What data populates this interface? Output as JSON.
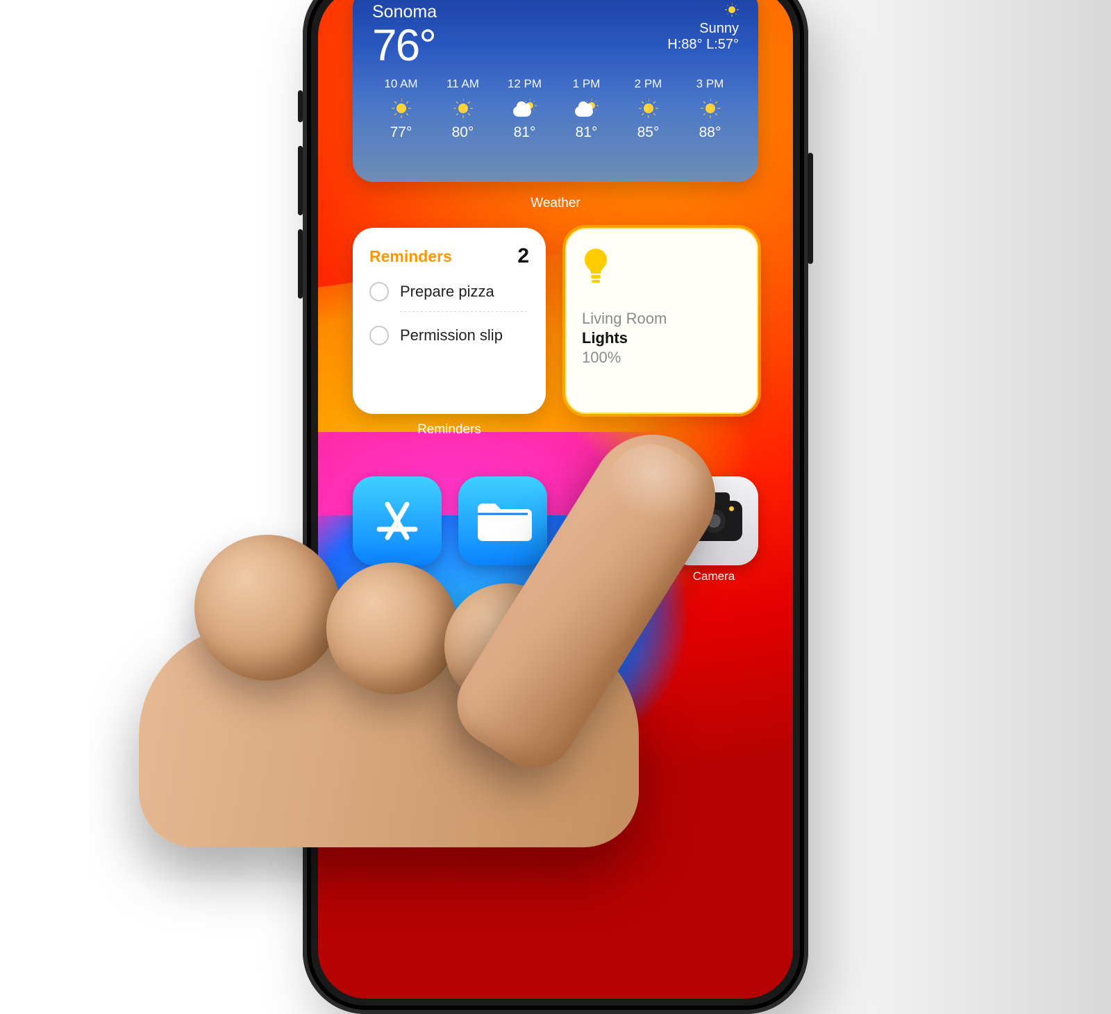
{
  "weather": {
    "location": "Sonoma",
    "current_temp": "76°",
    "condition": "Sunny",
    "hi_lo": "H:88° L:57°",
    "caption": "Weather",
    "hours": [
      {
        "time": "10 AM",
        "icon": "sun",
        "temp": "77°"
      },
      {
        "time": "11 AM",
        "icon": "sun",
        "temp": "80°"
      },
      {
        "time": "12 PM",
        "icon": "partly-cloudy",
        "temp": "81°"
      },
      {
        "time": "1 PM",
        "icon": "partly-cloudy",
        "temp": "81°"
      },
      {
        "time": "2 PM",
        "icon": "sun",
        "temp": "85°"
      },
      {
        "time": "3 PM",
        "icon": "sun",
        "temp": "88°"
      }
    ]
  },
  "reminders": {
    "title": "Reminders",
    "count": "2",
    "items": [
      {
        "text": "Prepare pizza"
      },
      {
        "text": "Permission slip"
      }
    ],
    "caption": "Reminders"
  },
  "home": {
    "room": "Living Room",
    "accessory": "Lights",
    "value": "100%",
    "active": true
  },
  "apps": {
    "camera_label": "Camera"
  }
}
